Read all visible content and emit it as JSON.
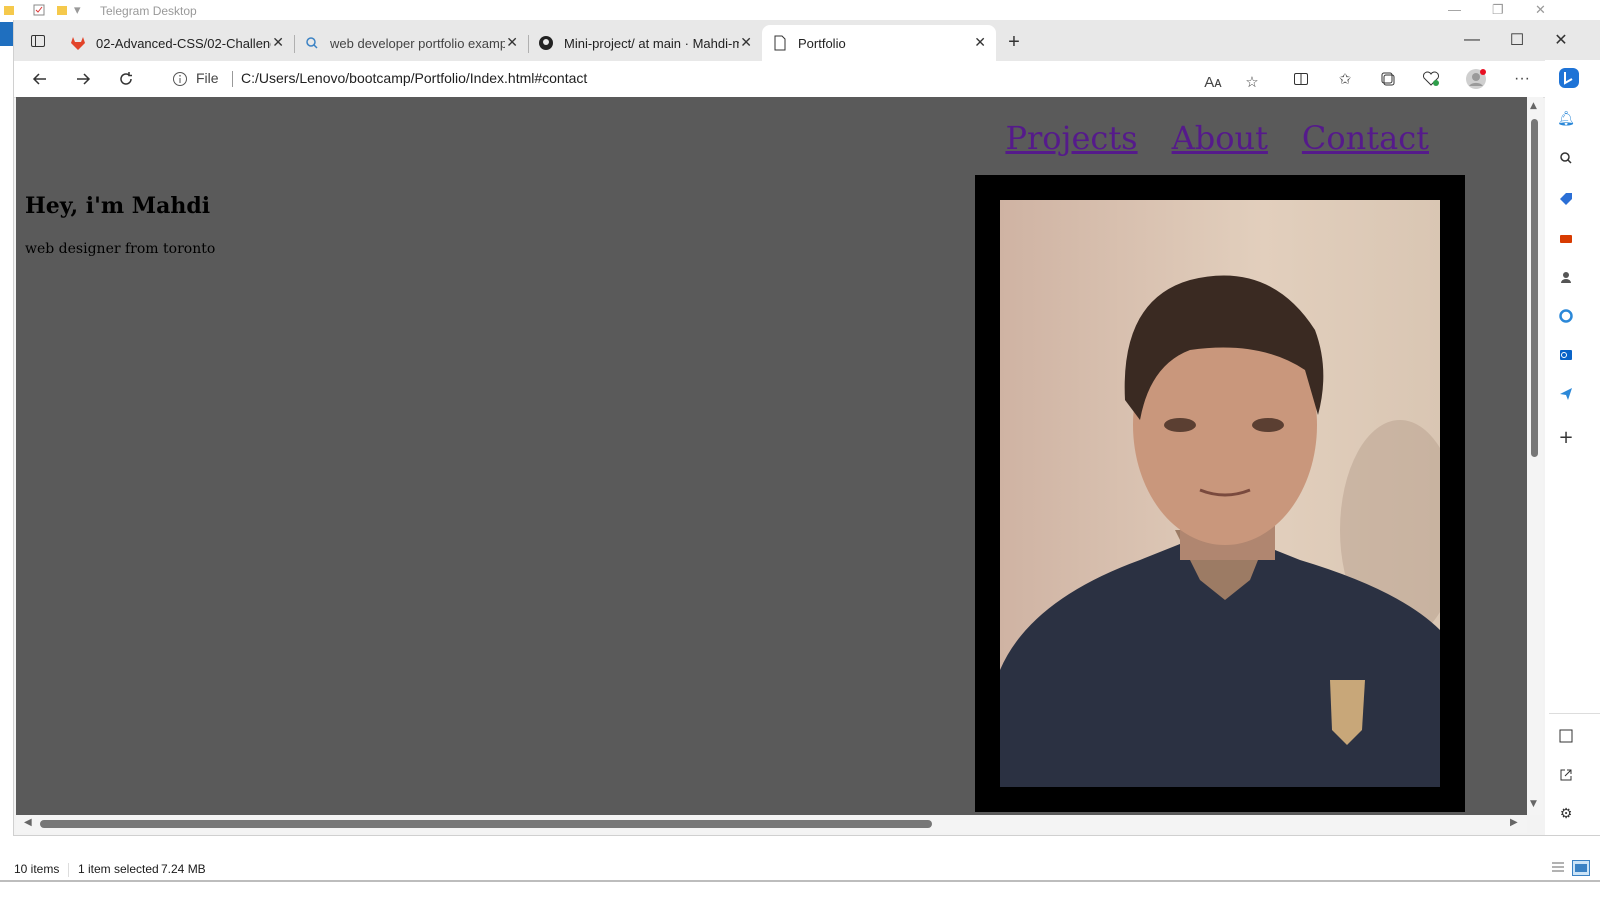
{
  "background_window": {
    "title": "Telegram Desktop"
  },
  "browser": {
    "tabs": [
      {
        "label": "02-Advanced-CSS/02-Challenge",
        "icon": "gitlab-icon",
        "active": false
      },
      {
        "label": "web developer portfolio example",
        "icon": "search-icon",
        "active": false
      },
      {
        "label": "Mini-project/ at main · Mahdi-m",
        "icon": "github-icon",
        "active": false
      },
      {
        "label": "Portfolio",
        "icon": "page-icon",
        "active": true
      }
    ],
    "address": {
      "scheme_label": "File",
      "url": "C:/Users/Lenovo/bootcamp/Portfolio/Index.html#contact"
    },
    "read_aloud_label": "Aᴀ"
  },
  "page": {
    "nav": [
      "Projects",
      "About",
      "Contact"
    ],
    "heading": "Hey, i'm Mahdi",
    "subheading": "web designer from toronto",
    "colors": {
      "background": "#5a5a5a",
      "link": "#551a8b",
      "frame": "#000000"
    }
  },
  "explorer_status": {
    "items_count": "10 items",
    "selected": "1 item selected",
    "size": "7.24 MB"
  }
}
